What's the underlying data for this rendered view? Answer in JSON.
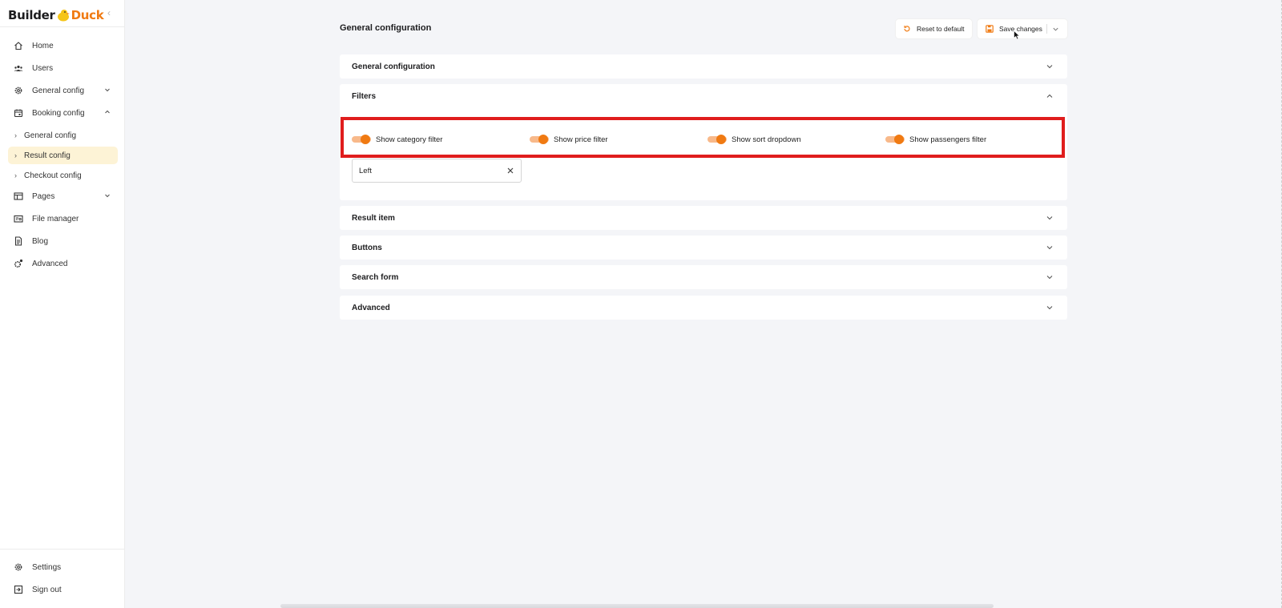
{
  "brand": {
    "part1": "Builder",
    "part2": "Duck"
  },
  "sidebar": {
    "items": [
      {
        "label": "Home",
        "icon": "home-icon"
      },
      {
        "label": "Users",
        "icon": "users-icon"
      },
      {
        "label": "General config",
        "icon": "gear-icon",
        "expandable": true
      },
      {
        "label": "Booking config",
        "icon": "calendar-icon",
        "expanded": true
      },
      {
        "label": "Pages",
        "icon": "table-icon",
        "expandable": true
      },
      {
        "label": "File manager",
        "icon": "folder-icon"
      },
      {
        "label": "Blog",
        "icon": "document-icon"
      },
      {
        "label": "Advanced",
        "icon": "advanced-gear-icon"
      }
    ],
    "sub_items": [
      {
        "label": "General config"
      },
      {
        "label": "Result config",
        "active": true
      },
      {
        "label": "Checkout config"
      }
    ],
    "bottom": [
      {
        "label": "Settings",
        "icon": "gear-icon"
      },
      {
        "label": "Sign out",
        "icon": "sign-out-icon"
      }
    ]
  },
  "header": {
    "title": "General configuration",
    "reset_label": "Reset to default",
    "save_label": "Save changes"
  },
  "panels": [
    {
      "title": "General configuration",
      "expanded": false
    },
    {
      "title": "Filters",
      "expanded": true
    },
    {
      "title": "Result item",
      "expanded": false
    },
    {
      "title": "Buttons",
      "expanded": false
    },
    {
      "title": "Search form",
      "expanded": false
    },
    {
      "title": "Advanced",
      "expanded": false
    }
  ],
  "filters": {
    "toggles": [
      {
        "label": "Show category filter",
        "on": true
      },
      {
        "label": "Show price filter",
        "on": true
      },
      {
        "label": "Show sort dropdown",
        "on": true
      },
      {
        "label": "Show passengers filter",
        "on": true
      }
    ],
    "position_value": "Left"
  },
  "colors": {
    "accent": "#f07a12",
    "toggle_track": "#f8b98a",
    "active_bg": "#fdf3d6",
    "highlight": "#e01d1d"
  }
}
